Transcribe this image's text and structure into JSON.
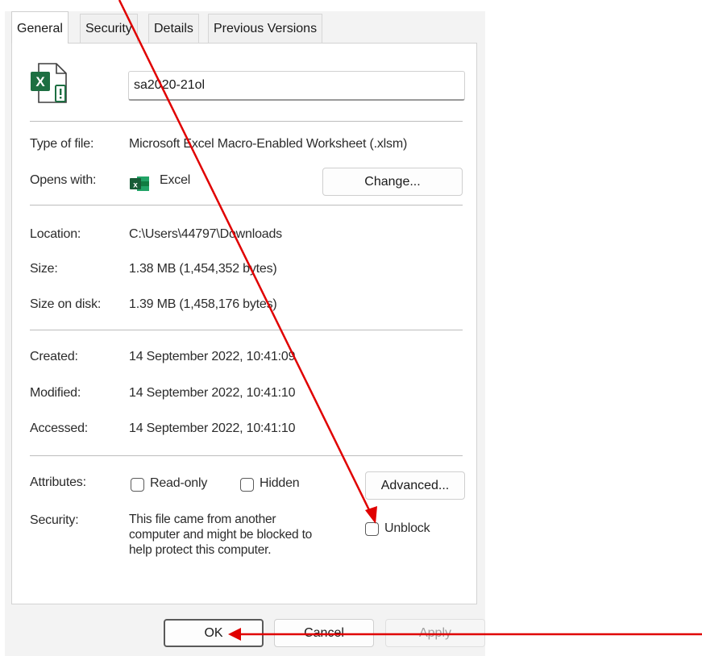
{
  "tabs": [
    {
      "label": "General"
    },
    {
      "label": "Security"
    },
    {
      "label": "Details"
    },
    {
      "label": "Previous Versions"
    }
  ],
  "file": {
    "name": "sa2020-21ol",
    "icon": "excel-file-icon"
  },
  "rows": {
    "type_label": "Type of file:",
    "type_value": "Microsoft Excel Macro-Enabled Worksheet (.xlsm)",
    "opens_label": "Opens with:",
    "opens_value": "Excel",
    "change_button": "Change...",
    "location_label": "Location:",
    "location_value": "C:\\Users\\44797\\Downloads",
    "size_label": "Size:",
    "size_value": "1.38 MB (1,454,352 bytes)",
    "size_disk_label": "Size on disk:",
    "size_disk_value": "1.39 MB (1,458,176 bytes)",
    "created_label": "Created:",
    "created_value": "14 September 2022, 10:41:09",
    "modified_label": "Modified:",
    "modified_value": "14 September 2022, 10:41:10",
    "accessed_label": "Accessed:",
    "accessed_value": "14 September 2022, 10:41:10",
    "attributes_label": "Attributes:",
    "readonly_label": "Read-only",
    "hidden_label": "Hidden",
    "advanced_button": "Advanced...",
    "security_label": "Security:",
    "security_line1": "This file came from another",
    "security_line2": "computer and might be blocked to",
    "security_line3": "help protect this computer.",
    "unblock_label": "Unblock"
  },
  "footer": {
    "ok": "OK",
    "cancel": "Cancel",
    "apply": "Apply"
  },
  "colors": {
    "excel_green": "#1d6f42",
    "arrow_red": "#e00000"
  }
}
